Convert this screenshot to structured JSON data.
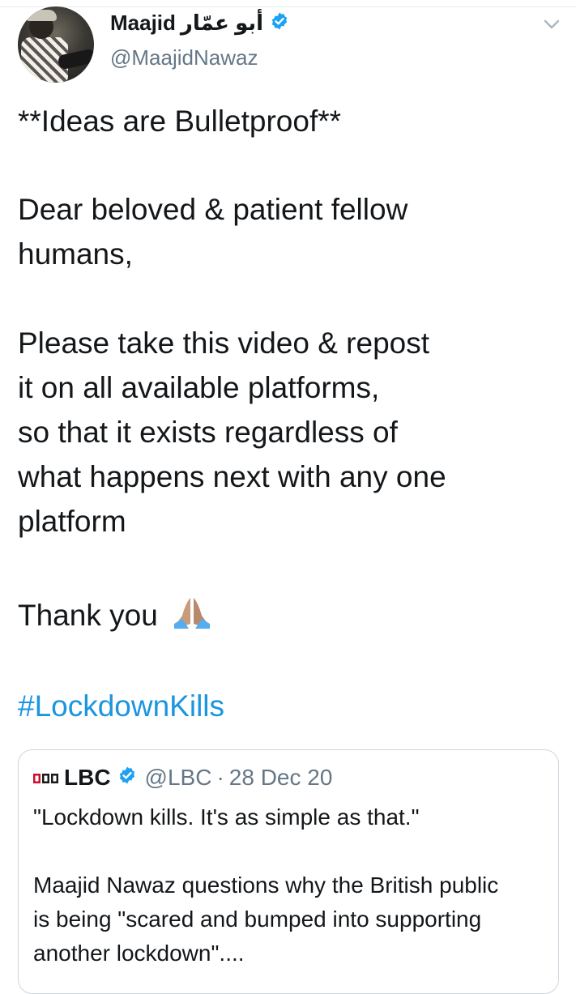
{
  "tweet": {
    "author_name": "Maajid",
    "author_name_arabic": "أبو عمّار",
    "handle": "@MaajidNawaz",
    "verified": true,
    "lines": [
      "**Ideas are Bulletproof**",
      "Dear beloved & patient fellow",
      "humans,",
      "Please take this video & repost",
      "it on all available platforms,",
      "so that it exists regardless of",
      "what happens next with any one",
      "platform",
      "Thank you"
    ],
    "emoji": "folded-hands",
    "hashtag": "#LockdownKills"
  },
  "quoted_tweet": {
    "logo_text": "LBC",
    "name": "LBC",
    "verified": true,
    "handle": "@LBC",
    "separator": "·",
    "date": "28 Dec 20",
    "lines": [
      "\"Lockdown kills. It's as simple as that.\"",
      "Maajid Nawaz questions why the British public",
      "is being \"scared and bumped into supporting",
      "another lockdown\"...."
    ]
  },
  "colors": {
    "text": "#14171a",
    "secondary": "#657786",
    "link": "#1b95e0",
    "verified": "#1da1f2",
    "border": "#ccd6dd"
  }
}
